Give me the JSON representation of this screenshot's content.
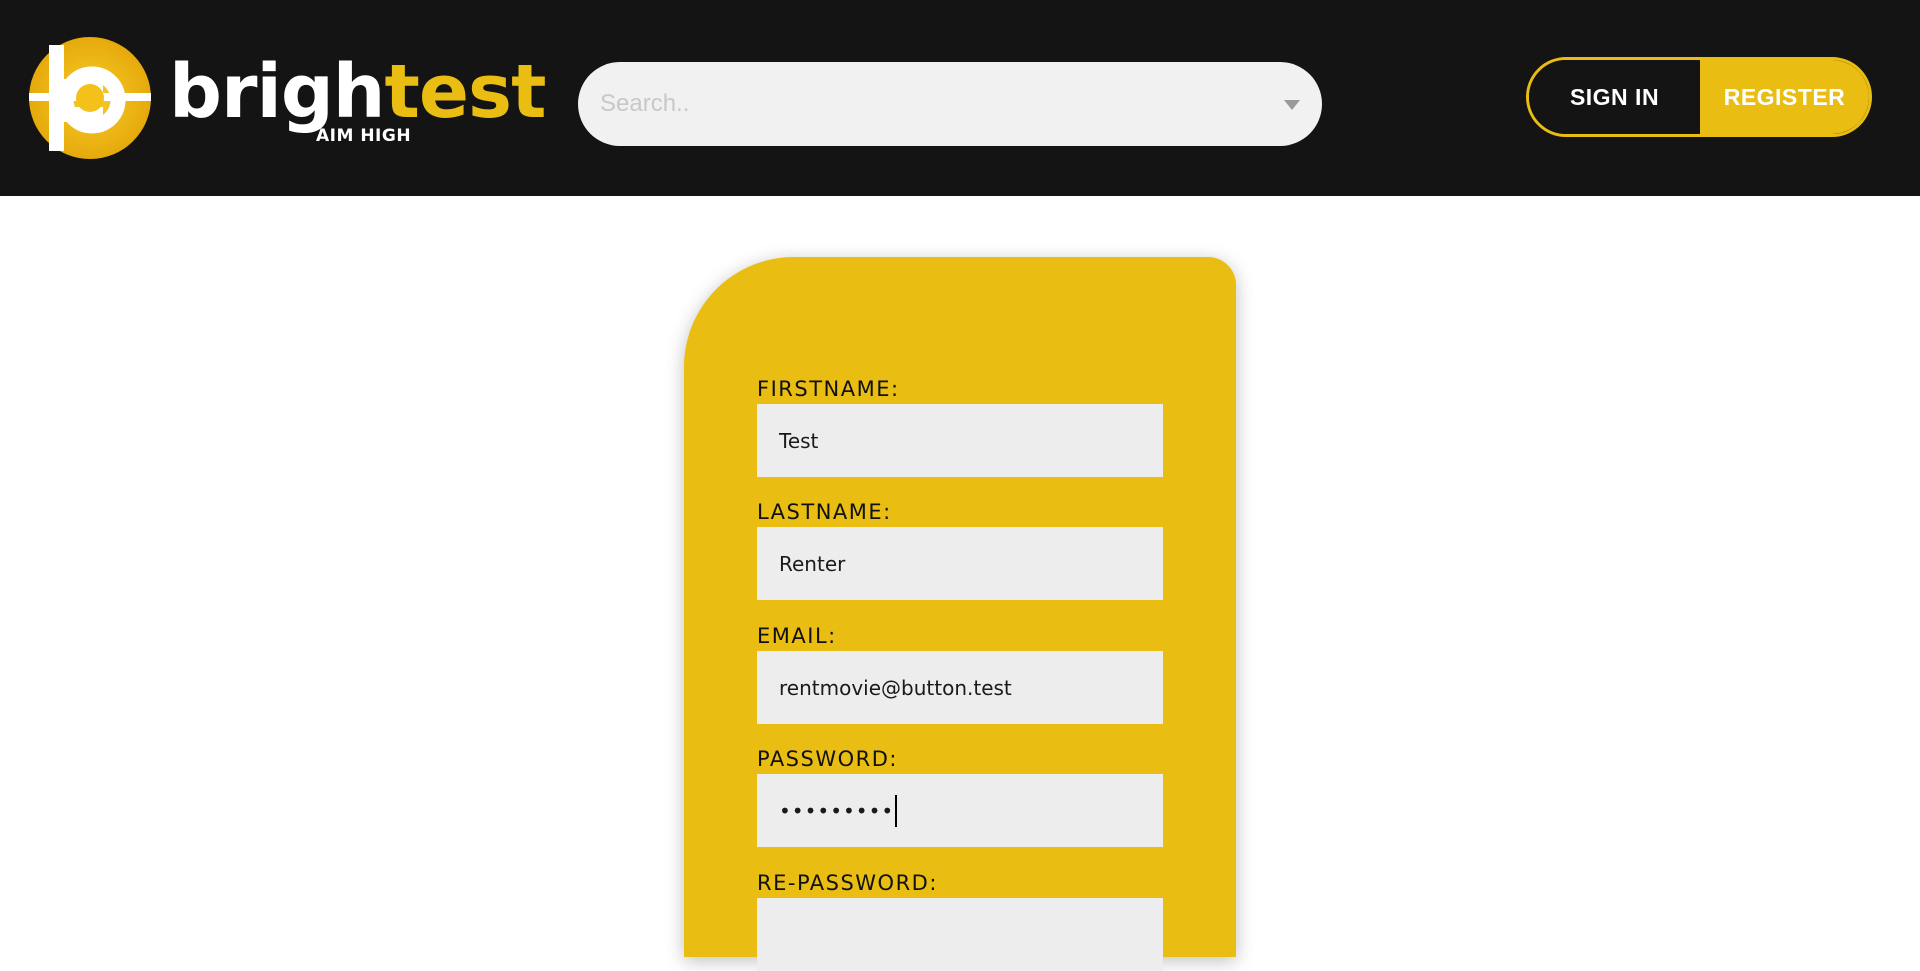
{
  "header": {
    "logo": {
      "word_part1": "brigh",
      "word_part2": "test",
      "tagline": "AIM HIGH"
    },
    "search": {
      "placeholder": "Search..",
      "value": ""
    },
    "auth": {
      "signin_label": "SIGN IN",
      "register_label": "REGISTER"
    }
  },
  "form": {
    "firstname": {
      "label": "FIRSTNAME:",
      "value": "Test"
    },
    "lastname": {
      "label": "LASTNAME:",
      "value": "Renter"
    },
    "email": {
      "label": "EMAIL:",
      "value": "rentmovie@button.test"
    },
    "password": {
      "label": "PASSWORD:",
      "masked_value": "•••••••••"
    },
    "repassword": {
      "label": "RE-PASSWORD:"
    }
  },
  "colors": {
    "brand_yellow": "#e9bd12",
    "header_bg": "#141414",
    "input_bg": "#ededed"
  },
  "icons": {
    "search_dropdown": "caret-down-icon",
    "logo": "brightest-logo-icon"
  }
}
